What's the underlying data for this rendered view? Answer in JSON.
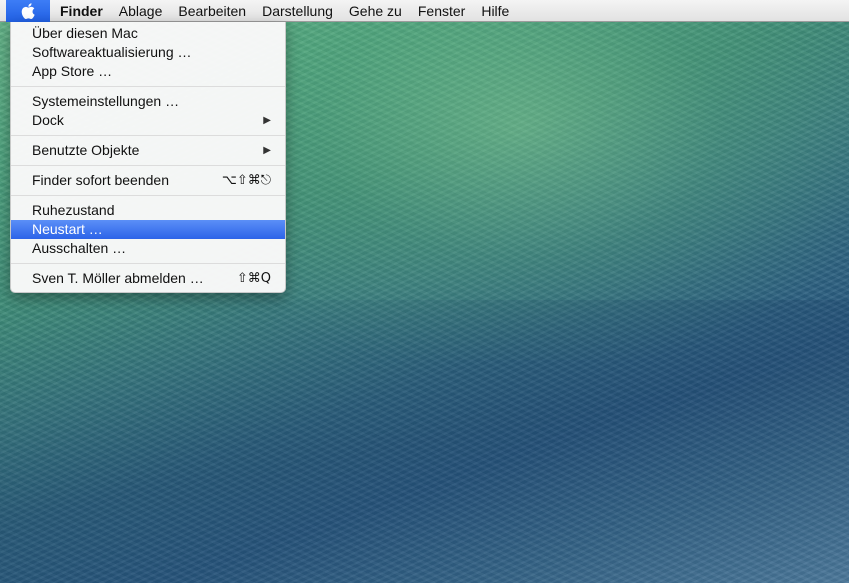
{
  "menubar": {
    "apple_icon": "apple-logo-icon",
    "items": [
      "Finder",
      "Ablage",
      "Bearbeiten",
      "Darstellung",
      "Gehe zu",
      "Fenster",
      "Hilfe"
    ]
  },
  "apple_menu": {
    "groups": [
      [
        {
          "label": "Über diesen Mac"
        },
        {
          "label": "Softwareaktualisierung …"
        },
        {
          "label": "App Store …"
        }
      ],
      [
        {
          "label": "Systemeinstellungen …"
        },
        {
          "label": "Dock",
          "submenu_icon": "submenu-arrow-icon"
        }
      ],
      [
        {
          "label": "Benutzte Objekte",
          "submenu_icon": "submenu-arrow-icon"
        }
      ],
      [
        {
          "label": "Finder sofort beenden",
          "shortcut": "⌥⇧⌘⎋"
        }
      ],
      [
        {
          "label": "Ruhezustand"
        },
        {
          "label": "Neustart …",
          "selected": true
        },
        {
          "label": "Ausschalten …"
        }
      ],
      [
        {
          "label": "Sven T. Möller abmelden …",
          "shortcut": "⇧⌘Q"
        }
      ]
    ]
  },
  "colors": {
    "selection": "#2c63e8",
    "menubar": "#e8e8e8"
  }
}
